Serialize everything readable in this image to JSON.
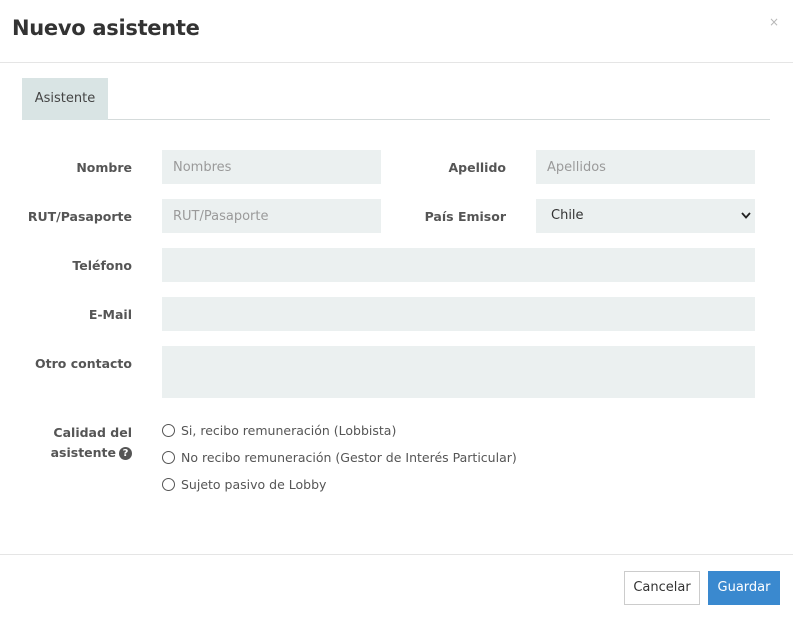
{
  "header": {
    "title": "Nuevo asistente",
    "close_glyph": "×"
  },
  "tabs": [
    {
      "label": "Asistente"
    }
  ],
  "form": {
    "nombre": {
      "label": "Nombre",
      "placeholder": "Nombres",
      "value": ""
    },
    "apellido": {
      "label": "Apellido",
      "placeholder": "Apellidos",
      "value": ""
    },
    "rut": {
      "label": "RUT/Pasaporte",
      "placeholder": "RUT/Pasaporte",
      "value": ""
    },
    "pais": {
      "label": "País Emisor",
      "selected": "Chile"
    },
    "telefono": {
      "label": "Teléfono",
      "value": ""
    },
    "email": {
      "label": "E-Mail",
      "value": ""
    },
    "otro": {
      "label": "Otro contacto",
      "value": ""
    },
    "calidad": {
      "label_line1": "Calidad del",
      "label_line2": "asistente",
      "help_glyph": "?",
      "options": [
        {
          "label": "Si, recibo remuneración (Lobbista)",
          "checked": false
        },
        {
          "label": "No recibo remuneración (Gestor de Interés Particular)",
          "checked": false
        },
        {
          "label": "Sujeto pasivo de Lobby",
          "checked": false
        }
      ]
    }
  },
  "footer": {
    "cancel_label": "Cancelar",
    "save_label": "Guardar"
  },
  "colors": {
    "accent": "#3a89cf",
    "field_bg": "#ebf0f0",
    "tab_bg": "#d9e4e4"
  },
  "icons": {
    "close": "close-icon",
    "help": "help-icon",
    "dropdown": "chevron-down-icon"
  }
}
